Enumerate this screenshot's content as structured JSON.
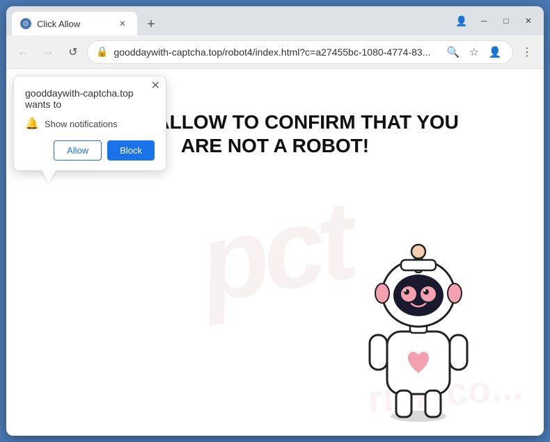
{
  "window": {
    "title": "Click Allow",
    "favicon": "●"
  },
  "titlebar": {
    "minimize": "─",
    "maximize": "□",
    "close": "✕",
    "newtab": "+",
    "profileIcon": "👤",
    "menuIcon": "⋮"
  },
  "navbar": {
    "back": "←",
    "forward": "→",
    "refresh": "↺",
    "url": "gooddaywith-captcha.top/robot4/index.html?c=a27455bc-1080-4774-83...",
    "search_icon": "🔍",
    "star_icon": "☆",
    "profile": "👤",
    "menu": "⋮"
  },
  "notification_popup": {
    "site": "gooddaywith-captcha.top wants to",
    "notification_label": "Show notifications",
    "allow_label": "Allow",
    "block_label": "Block",
    "close": "✕"
  },
  "page": {
    "headline_line1": "CLICK ALLOW TO CONFIRM THAT YOU",
    "headline_line2": "ARE NOT A ROBOT!",
    "watermark": "pct",
    "watermark2": "risk.co..."
  }
}
